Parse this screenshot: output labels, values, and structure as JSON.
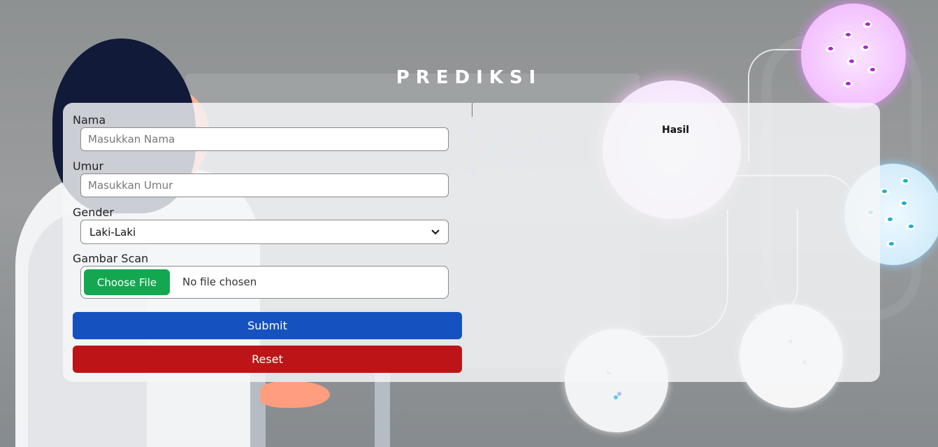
{
  "page": {
    "title": "PREDIKSI"
  },
  "form": {
    "name_label": "Nama",
    "name_placeholder": "Masukkan Nama",
    "age_label": "Umur",
    "age_placeholder": "Masukkan Umur",
    "gender_label": "Gender",
    "gender_value": "Laki-Laki",
    "image_label": "Gambar Scan",
    "choose_file_label": "Choose File",
    "file_status": "No file chosen",
    "submit_label": "Submit",
    "reset_label": "Reset"
  },
  "result": {
    "label": "Hasil"
  },
  "colors": {
    "submit": "#1552bf",
    "reset": "#bd1517",
    "choose_file": "#13a850"
  }
}
